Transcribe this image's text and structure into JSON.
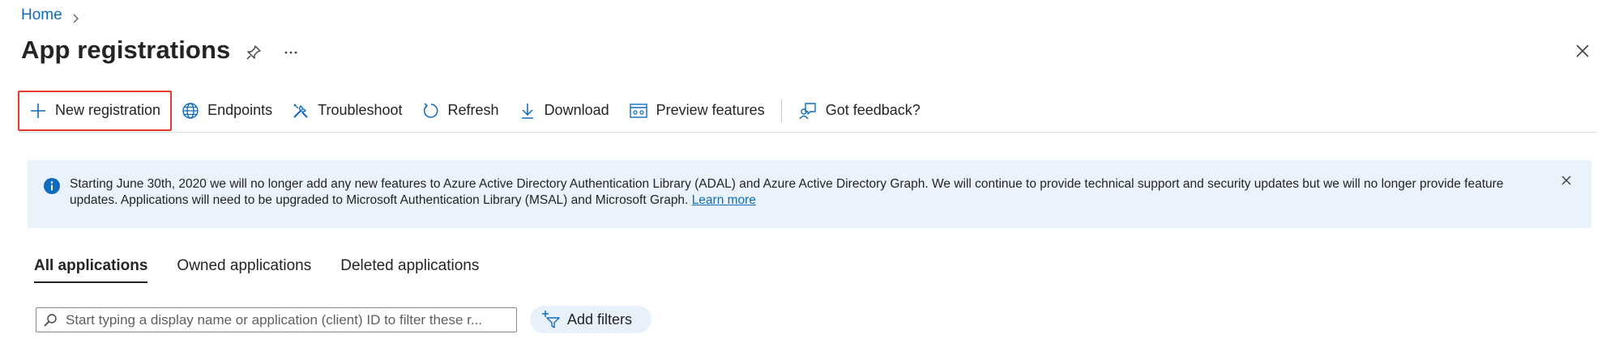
{
  "breadcrumb": {
    "home": "Home"
  },
  "header": {
    "title": "App registrations"
  },
  "toolbar": {
    "new_registration": "New registration",
    "endpoints": "Endpoints",
    "troubleshoot": "Troubleshoot",
    "refresh": "Refresh",
    "download": "Download",
    "preview_features": "Preview features",
    "feedback": "Got feedback?"
  },
  "banner": {
    "text": "Starting June 30th, 2020 we will no longer add any new features to Azure Active Directory Authentication Library (ADAL) and Azure Active Directory Graph. We will continue to provide technical support and security updates but we will no longer provide feature updates. Applications will need to be upgraded to Microsoft Authentication Library (MSAL) and Microsoft Graph.",
    "link": "Learn more"
  },
  "tabs": [
    {
      "label": "All applications",
      "active": true
    },
    {
      "label": "Owned applications",
      "active": false
    },
    {
      "label": "Deleted applications",
      "active": false
    }
  ],
  "search": {
    "placeholder": "Start typing a display name or application (client) ID to filter these r..."
  },
  "filters": {
    "add_filters": "Add filters"
  },
  "colors": {
    "accent": "#0f6cbd",
    "highlight_border": "#e53b2c",
    "banner_bg": "#eaf3fc"
  },
  "icons": {
    "home_chevron": "chevron-right-icon",
    "pin": "pin-icon",
    "more": "more-icon",
    "close": "close-icon",
    "new": "plus-icon",
    "endpoints": "globe-icon",
    "troubleshoot": "tools-icon",
    "refresh": "refresh-icon",
    "download": "download-icon",
    "preview": "preview-icon",
    "feedback": "feedback-icon",
    "info": "info-icon",
    "search": "search-icon",
    "filter": "add-filter-icon"
  }
}
